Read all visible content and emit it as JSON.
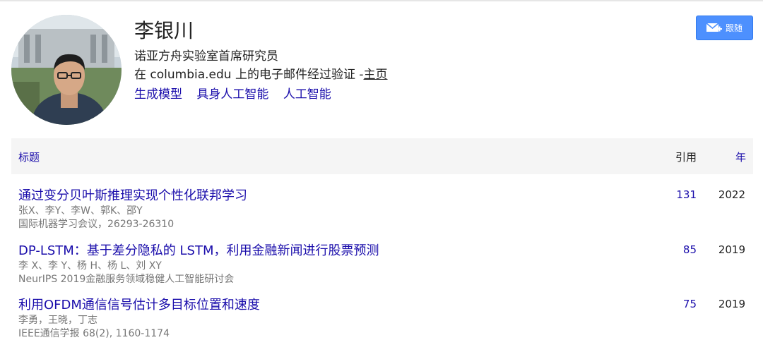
{
  "profile": {
    "name": "李银川",
    "affiliation": "诺亚方舟实验室首席研究员",
    "email_text": "在 columbia.edu 上的电子邮件经过验证 -",
    "homepage_label": "主页",
    "interests": [
      "生成模型",
      "具身人工智能",
      "人工智能"
    ],
    "avatar_icon": "profile-photo"
  },
  "actions": {
    "follow_label": "跟随",
    "follow_icon": "mail-plus-icon",
    "accent": "#4d90fe"
  },
  "table": {
    "headers": {
      "title": "标题",
      "cited": "引用",
      "year": "年"
    },
    "rows": [
      {
        "title": "通过变分贝叶斯推理实现个性化联邦学习",
        "authors": "张X、李Y、李W、郭K、邵Y",
        "venue": "国际机器学习会议，26293-26310",
        "cited": "131",
        "year": "2022"
      },
      {
        "title": "DP-LSTM：基于差分隐私的 LSTM，利用金融新闻进行股票预测",
        "authors": "李 X、李 Y、杨 H、杨 L、刘 XY",
        "venue": "NeurIPS 2019金融服务领域稳健人工智能研讨会",
        "cited": "85",
        "year": "2019"
      },
      {
        "title": "利用OFDM通信信号估计多目标位置和速度",
        "authors": "李勇，王晓，丁志",
        "venue": "IEEE通信学报 68(2), 1160-1174",
        "cited": "75",
        "year": "2019"
      }
    ]
  }
}
